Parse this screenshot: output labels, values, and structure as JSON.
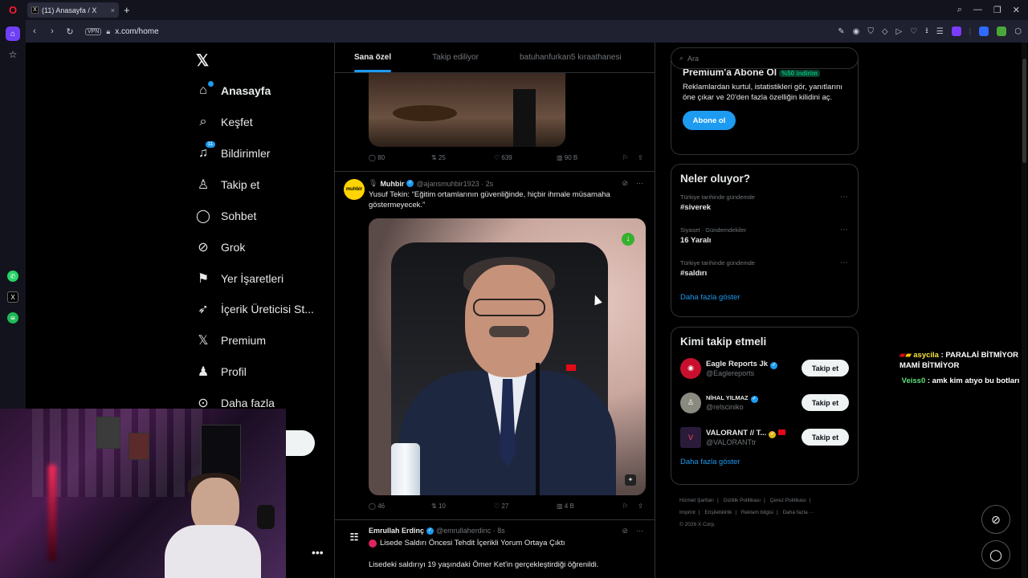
{
  "browser": {
    "tab_title": "(11) Anasayfa / X",
    "tab_favicon": "X",
    "new_tab": "+",
    "vpn_label": "VPN",
    "url": "x.com/home"
  },
  "opera_sidebar": {
    "items": [
      "home-icon",
      "pinboard-icon",
      "whatsapp-icon",
      "x-icon",
      "spotify-icon"
    ]
  },
  "x_nav": {
    "logo": "𝕏",
    "items": [
      {
        "label": "Anasayfa",
        "icon": "home-icon",
        "glyph": "⌂",
        "active": true
      },
      {
        "label": "Keşfet",
        "icon": "search-icon",
        "glyph": "⌕"
      },
      {
        "label": "Bildirimler",
        "icon": "bell-icon",
        "glyph": "🔔",
        "badge": "11"
      },
      {
        "label": "Takip et",
        "icon": "add-user-icon",
        "glyph": "👤"
      },
      {
        "label": "Sohbet",
        "icon": "chat-icon",
        "glyph": "◯"
      },
      {
        "label": "Grok",
        "icon": "grok-icon",
        "glyph": "⌀"
      },
      {
        "label": "Yer İşaretleri",
        "icon": "bookmark-icon",
        "glyph": "⚐"
      },
      {
        "label": "İçerik Üreticisi St...",
        "icon": "rocket-icon",
        "glyph": "➶"
      },
      {
        "label": "Premium",
        "icon": "x-premium-icon",
        "glyph": "𝕏"
      },
      {
        "label": "Profil",
        "icon": "profile-icon",
        "glyph": "♙"
      },
      {
        "label": "Daha fazla",
        "icon": "more-icon",
        "glyph": "⋯"
      }
    ],
    "more_dots": "•••"
  },
  "timeline": {
    "tabs": [
      "Sana özel",
      "Takip ediliyor",
      "batuhanfurkan5 kıraathanesi"
    ],
    "prev_post_actions": {
      "replies": "80",
      "reposts": "25",
      "likes": "639",
      "views": "90 B"
    },
    "post1": {
      "avatar_text": "muhbir",
      "name": "Muhbir",
      "handle": "@ajansmuhbir1923 · 2s",
      "text": "Yusuf Tekin: “Eğitim ortamlarının güvenliğinde, hiçbir ihmale müsamaha göstermeyecek.”",
      "actions": {
        "replies": "46",
        "reposts": "10",
        "likes": "27",
        "views": "4 B"
      }
    },
    "post2": {
      "name": "Emrullah Erdinç",
      "handle": "@emrullaherdinc · 8s",
      "line1": "Lisede Saldırı Öncesi Tehdit İçerikli Yorum Ortaya Çıktı",
      "line2": "Lisedeki saldırıyı 19 yaşındaki Ömer Ket'in gerçekleştirdiği öğrenildi."
    }
  },
  "right": {
    "search_placeholder": "Ara",
    "premium": {
      "title": "Premium'a Abone Ol",
      "discount": "%50 indirim",
      "text": "Reklamlardan kurtul, istatistikleri gör, yanıtlarını öne çıkar ve 20'den fazla özelliğin kilidini aç.",
      "button": "Abone ol"
    },
    "trends": {
      "title": "Neler oluyor?",
      "items": [
        {
          "context": "Türkiye tarihinde gündemde",
          "topic": "#siverek"
        },
        {
          "context": "Siyaset · Gündemdekiler",
          "topic": "16 Yaralı"
        },
        {
          "context": "Türkiye tarihinde gündemde",
          "topic": "#saldırı"
        }
      ],
      "show_more": "Daha fazla göster"
    },
    "who_to_follow": {
      "title": "Kimi takip etmeli",
      "items": [
        {
          "name": "Eagle Reports Jk",
          "handle": "@Eaglereports",
          "button": "Takip et",
          "color": "#c8102e"
        },
        {
          "name": "NİHAL YILMAZ",
          "handle": "@relsciniko",
          "button": "Takip et",
          "color": "#8a8a80"
        },
        {
          "name": "VALORANT // T...",
          "handle": "@VALORANTtr",
          "button": "Takip et",
          "color": "#2b1b3b"
        }
      ],
      "show_more": "Daha fazla göster"
    },
    "footer": [
      "Hizmet Şartları",
      "|",
      "Gizlilik Politikası",
      "|",
      "Çerez Politikası",
      "|",
      "Imprint",
      "|",
      "Erişilebilirlik",
      "|",
      "Reklam bilgisi",
      "|",
      "Daha fazla ···",
      "© 2026 X Corp."
    ]
  },
  "stream_chat": [
    {
      "user": "asycila",
      "message": ": PARALAİ BİTMİYOR MAMİ BİTMİYOR"
    },
    {
      "user": "Veiss0",
      "message": ": amk kim atıyo bu botları"
    }
  ]
}
